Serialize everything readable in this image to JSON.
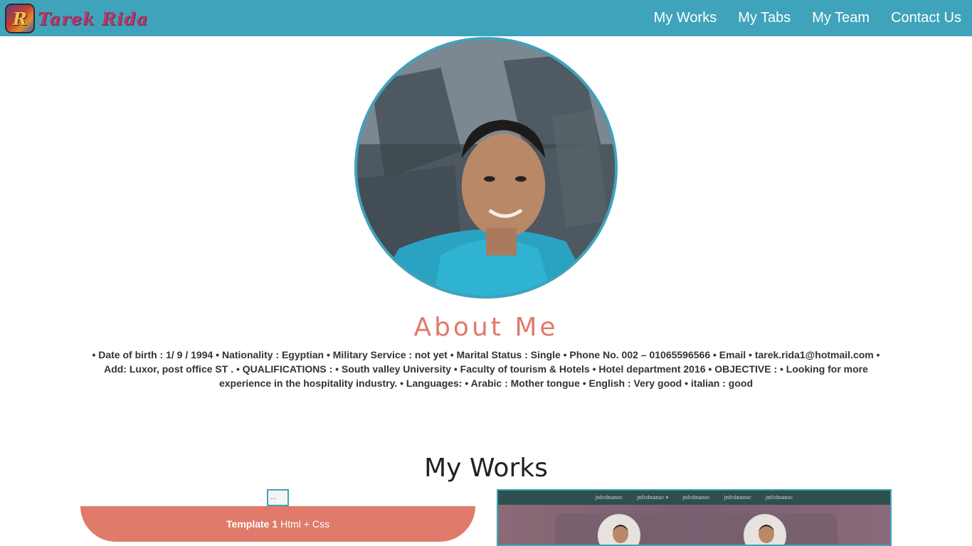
{
  "navbar": {
    "logo_letter": "R",
    "logo_text": "Tarek Rida",
    "links": [
      "My Works",
      "My Tabs",
      "My Team",
      "Contact Us"
    ]
  },
  "about": {
    "title": "About Me",
    "text": "• Date of birth : 1/ 9 / 1994 • Nationality : Egyptian • Military Service : not yet • Marital Status : Single • Phone No. 002 – 01065596566 • Email • tarek.rida1@hotmail.com • Add: Luxor, post office ST . • QUALIFICATIONS : • South valley University • Faculty of tourism & Hotels • Hotel department 2016 • OBJECTIVE : • Looking for more experience in the hospitality industry. • Languages: • Arabic : Mother tongue • English : Very good • italian : good"
  },
  "works": {
    "title": "My Works",
    "broken_image_alt": "...",
    "template_name": "Template 1",
    "template_tech": "Html + Css",
    "preview_nav": [
      "jnfcdnansc",
      "jnfcdnansc ▾",
      "jnfcdnansc",
      "jnfcdnansc",
      "jnfcdnansc"
    ]
  },
  "colors": {
    "navbar": "#3fa3bb",
    "accent": "#e07a6a"
  }
}
